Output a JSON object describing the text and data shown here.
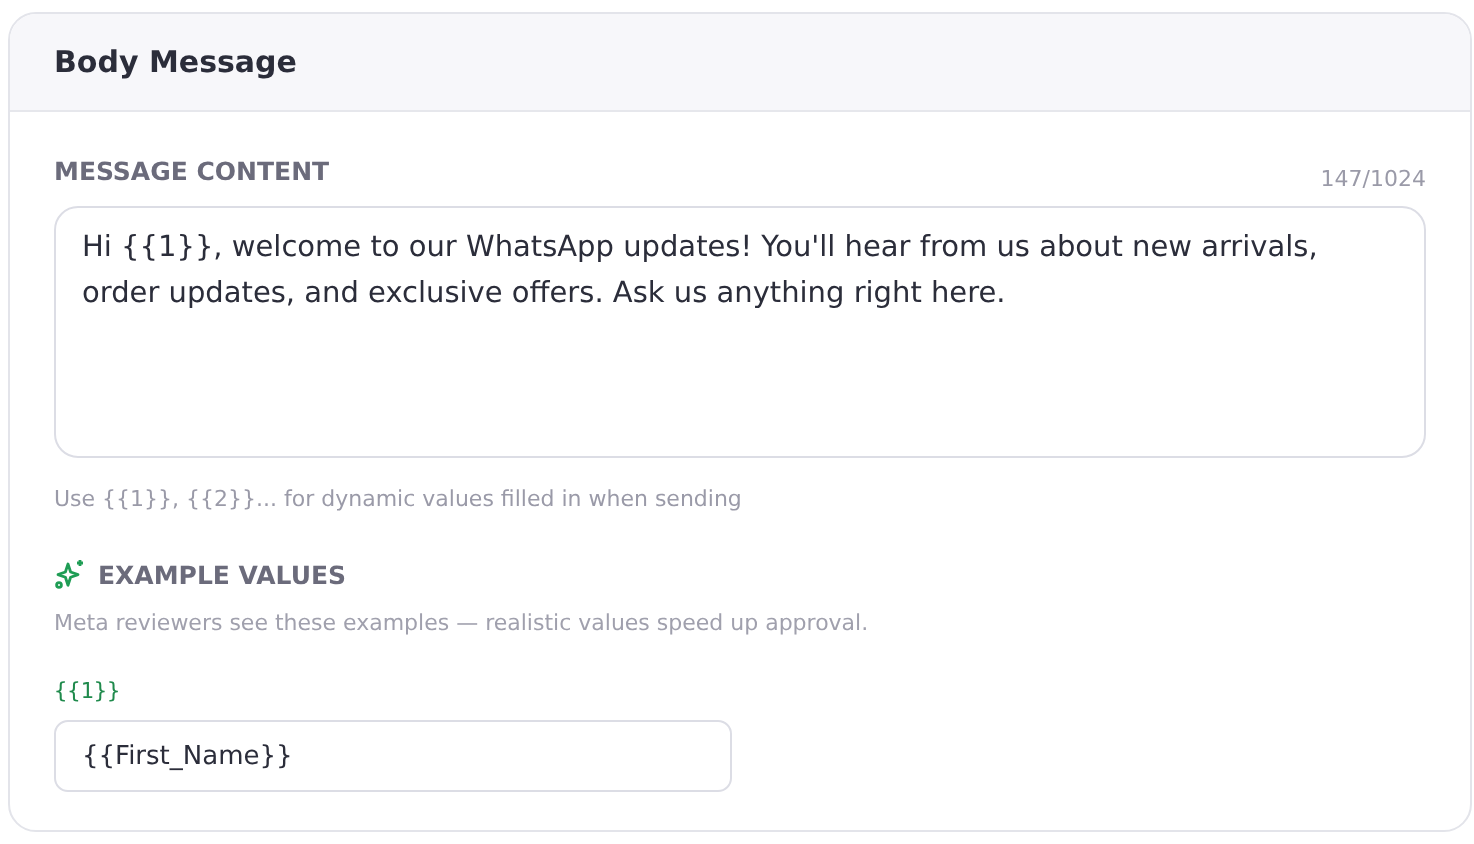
{
  "card": {
    "title": "Body Message"
  },
  "message": {
    "label": "MESSAGE CONTENT",
    "counter": "147/1024",
    "value": "Hi {{1}}, welcome to our WhatsApp updates! You'll hear from us about new arrivals, order updates, and exclusive offers. Ask us anything right here.",
    "hint": "Use {{1}}, {{2}}... for dynamic values filled in when sending"
  },
  "examples": {
    "title": "EXAMPLE VALUES",
    "description": "Meta reviewers see these examples — realistic values speed up approval.",
    "variables": [
      {
        "label": "{{1}}",
        "value": "{{First_Name}}"
      }
    ]
  }
}
